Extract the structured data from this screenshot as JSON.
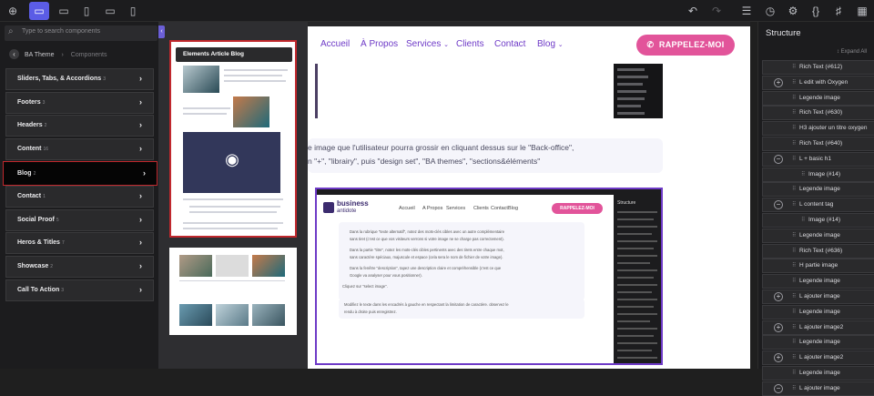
{
  "toolbar": {
    "left_icons": [
      "add-icon",
      "desktop-icon",
      "laptop-icon",
      "tablet-icon",
      "tablet-landscape-icon",
      "mobile-icon"
    ],
    "right_icons": [
      "undo-icon",
      "redo-icon",
      "layers-icon",
      "history-icon",
      "settings-icon",
      "code-icon",
      "css-icon",
      "grid-icon"
    ]
  },
  "components_panel": {
    "search_placeholder": "Type to search components",
    "breadcrumb": {
      "current": "BA Theme",
      "sub": "Components"
    },
    "categories": [
      {
        "label": "Sliders, Tabs, & Accordions",
        "count": "3"
      },
      {
        "label": "Footers",
        "count": "3"
      },
      {
        "label": "Headers",
        "count": "2"
      },
      {
        "label": "Content",
        "count": "16"
      },
      {
        "label": "Blog",
        "count": "2",
        "selected": true
      },
      {
        "label": "Contact",
        "count": "1"
      },
      {
        "label": "Social Proof",
        "count": "5"
      },
      {
        "label": "Heros & Titles",
        "count": "7"
      },
      {
        "label": "Showcase",
        "count": "2"
      },
      {
        "label": "Call To Action",
        "count": "3"
      }
    ]
  },
  "gallery": {
    "card_title": "Elements Article Blog",
    "preview_icon": "eye-icon"
  },
  "site": {
    "nav": [
      "Accueil",
      "À Propos",
      "Services",
      "Clients",
      "Contact",
      "Blog"
    ],
    "cta": "RAPPELEZ-MOI",
    "paragraph_line1": "e image que l'utilisateur pourra grossir en cliquant dessus sur le \"Back-office\",",
    "paragraph_line2": "n \"+\", \"librairy\", puis \"design set\", \"BA themes\", \"sections&éléments\""
  },
  "embedded": {
    "logo_top": "business",
    "logo_bottom": "antidote",
    "nav": [
      "Accueil",
      "A Propos",
      "Services",
      "Clients",
      "Contact",
      "Blog"
    ],
    "cta": "RAPPELEZ-MOI",
    "panel_title": "Structure",
    "bullets": [
      "Dans la rubrique \"texte alternatif\", notez des mots-clés cibles avec un autre complémentaire",
      "sans tiret (c'est ce que vos visiteurs verrons si votre image ne se charge pas correctement).",
      "Dans la partie \"titre\", notez les mots-clés cibles pertinents avec des tirets entre chaque mot,",
      "sans caractère spéciaux, majuscule et espace (cela sera le nom de fichier de votre image).",
      "Dans la fenêtre \"description\", tapez une description claire et compréhensible (c'est ce que",
      "Google va analyser pour vous positionner)."
    ],
    "cta_text": "Cliquez sur \"select image\".",
    "footer_line1": "Modifiez le texte dans les encadrés à gauche en respectant la limitation de caractère. observez le",
    "footer_line2": "rendu à droite puis enregistrez."
  },
  "structure": {
    "title": "Structure",
    "expand_all": "Expand All",
    "rows": [
      {
        "label": "Rich Text (#612)",
        "indent": 0,
        "toggle": ""
      },
      {
        "label": "L edit with Oxygen",
        "indent": 0,
        "toggle": "+"
      },
      {
        "label": "Legende image",
        "indent": 0,
        "toggle": ""
      },
      {
        "label": "Rich Text (#630)",
        "indent": 0,
        "toggle": ""
      },
      {
        "label": "H3 ajouter un titre oxygen",
        "indent": 0,
        "toggle": ""
      },
      {
        "label": "Rich Text (#640)",
        "indent": 0,
        "toggle": ""
      },
      {
        "label": "L + basic h1",
        "indent": 0,
        "toggle": "−"
      },
      {
        "label": "Image (#14)",
        "indent": 1,
        "toggle": ""
      },
      {
        "label": "Legende image",
        "indent": 0,
        "toggle": ""
      },
      {
        "label": "L content tag",
        "indent": 0,
        "toggle": "−"
      },
      {
        "label": "Image (#14)",
        "indent": 1,
        "toggle": ""
      },
      {
        "label": "Legende image",
        "indent": 0,
        "toggle": ""
      },
      {
        "label": "Rich Text (#636)",
        "indent": 0,
        "toggle": ""
      },
      {
        "label": "H partie image",
        "indent": 0,
        "toggle": ""
      },
      {
        "label": "Legende image",
        "indent": 0,
        "toggle": ""
      },
      {
        "label": "L ajouter image",
        "indent": 0,
        "toggle": "+"
      },
      {
        "label": "Legende image",
        "indent": 0,
        "toggle": ""
      },
      {
        "label": "L ajouter image2",
        "indent": 0,
        "toggle": "+"
      },
      {
        "label": "Legende image",
        "indent": 0,
        "toggle": ""
      },
      {
        "label": "L ajouter image2",
        "indent": 0,
        "toggle": "+"
      },
      {
        "label": "Legende image",
        "indent": 0,
        "toggle": ""
      },
      {
        "label": "L ajouter image",
        "indent": 0,
        "toggle": "−"
      }
    ]
  },
  "colors": {
    "accent": "#5b5ce6",
    "brand_purple": "#6e3ac7",
    "cta_pink": "#e2549a",
    "selection_red": "#c0282d"
  }
}
